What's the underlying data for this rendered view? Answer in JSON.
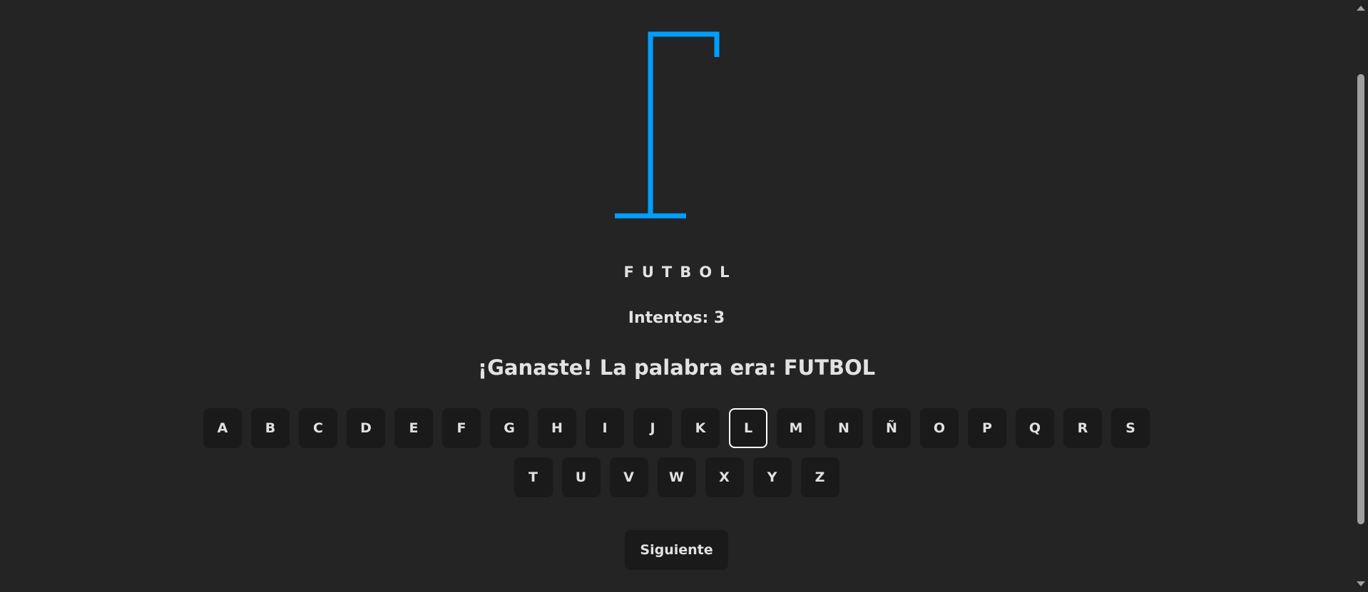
{
  "game": {
    "word_display": "FUTBOL",
    "attempts_text": "Intentos: 3",
    "message": "¡Ganaste! La palabra era: FUTBOL",
    "next_label": "Siguiente"
  },
  "keyboard": {
    "row1": [
      "A",
      "B",
      "C",
      "D",
      "E",
      "F",
      "G",
      "H",
      "I",
      "J",
      "K",
      "L",
      "M",
      "N",
      "Ñ",
      "O",
      "P",
      "Q",
      "R",
      "S"
    ],
    "row2": [
      "T",
      "U",
      "V",
      "W",
      "X",
      "Y",
      "Z"
    ],
    "selected_key": "L"
  },
  "colors": {
    "background": "#242424",
    "gallows": "#009eff",
    "key_background": "#1a1a1a",
    "selected_border": "#ffffff"
  },
  "icons": {
    "gallows": "hangman-gallows-icon"
  }
}
